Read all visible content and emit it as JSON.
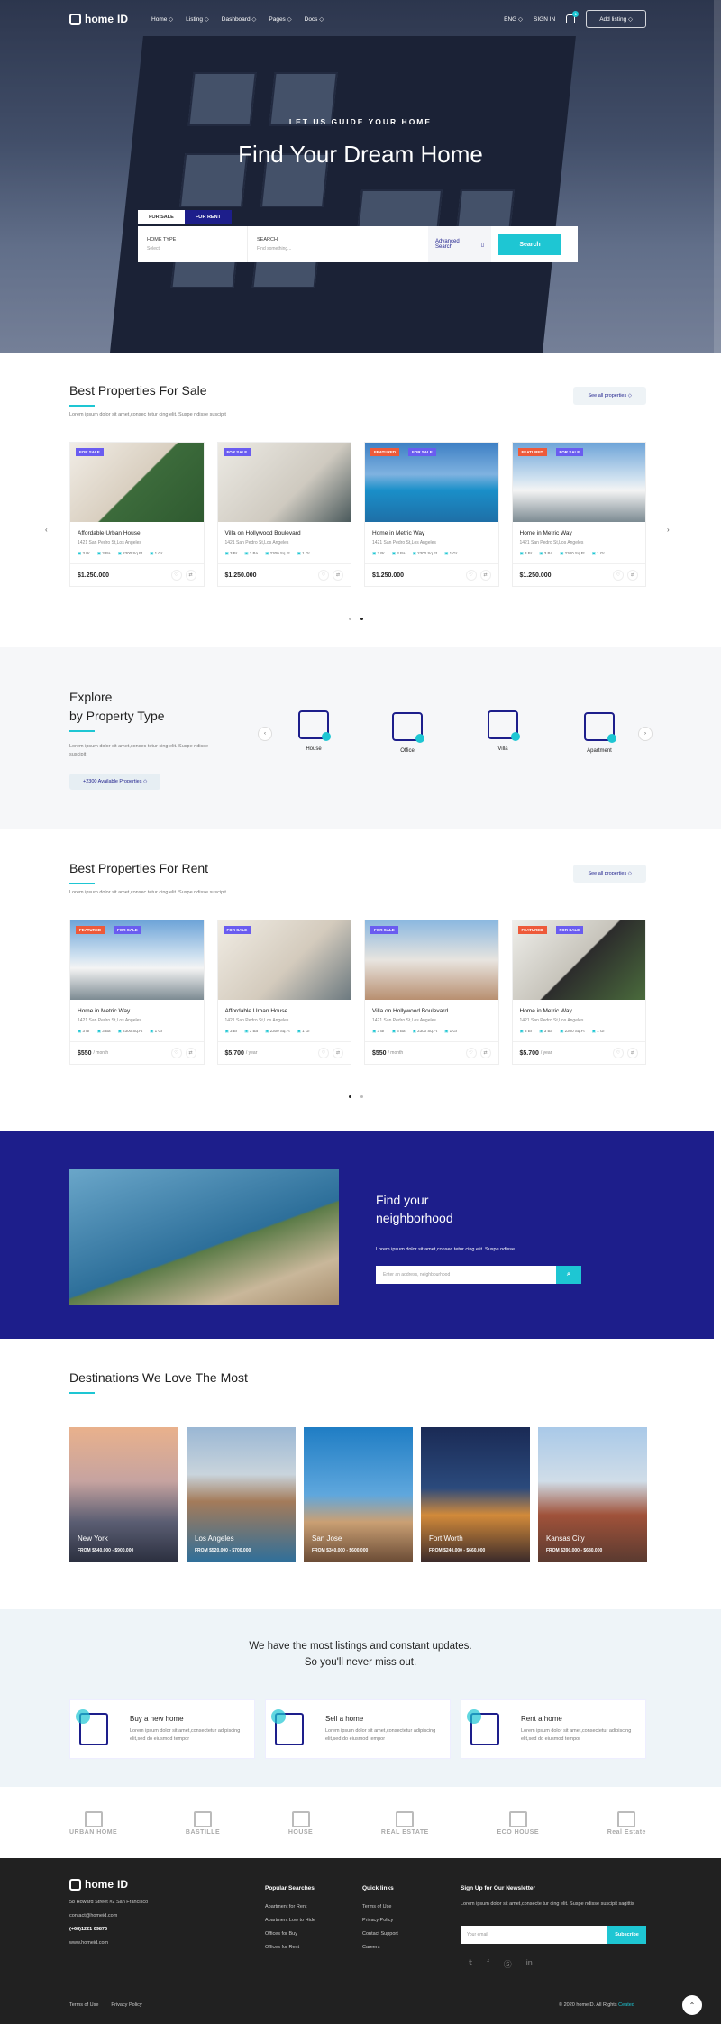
{
  "nav": {
    "logo_a": "home",
    "logo_b": "ID",
    "menu": [
      "Home ◇",
      "Listing ◇",
      "Dashboard ◇",
      "Pages ◇",
      "Docs ◇"
    ],
    "lang": "ENG ◇",
    "signin": "SIGN IN",
    "notif": "1",
    "add": "Add listing ◇"
  },
  "hero": {
    "kicker": "LET US GUIDE YOUR HOME",
    "title": "Find Your Dream Home",
    "tab_sale": "FOR SALE",
    "tab_rent": "FOR RENT",
    "type_label": "HOME TYPE",
    "type_value": "Select",
    "search_label": "SEARCH",
    "search_placeholder": "Find something...",
    "advanced": "Advanced Search",
    "go": "Search"
  },
  "sale": {
    "title": "Best Properties For Sale",
    "sub": "Lorem ipsum dolor sit amet,consec tetur cing elit. Suspe ndisse suscipit",
    "see_all": "See all properties  ◇",
    "cards": [
      {
        "title": "Affordable Urban House",
        "addr": "1421 San Pedro St,Los Angeles",
        "b1": "3 Br",
        "b2": "3 Ba",
        "b3": "2300 Sq.Ft",
        "b4": "1 Gr",
        "price": "$1.250.000",
        "period": "",
        "badges": [
          "FOR SALE"
        ]
      },
      {
        "title": "Villa on Hollywood Boulevard",
        "addr": "1421 San Pedro St,Los Angeles",
        "b1": "3 Br",
        "b2": "3 Ba",
        "b3": "2300 Sq.Ft",
        "b4": "1 Gr",
        "price": "$1.250.000",
        "period": "",
        "badges": [
          "FOR SALE"
        ]
      },
      {
        "title": "Home in Metric Way",
        "addr": "1421 San Pedro St,Los Angeles",
        "b1": "3 Br",
        "b2": "3 Ba",
        "b3": "2300 Sq.Ft",
        "b4": "1 Gr",
        "price": "$1.250.000",
        "period": "",
        "badges": [
          "FEATURED",
          "FOR SALE"
        ]
      },
      {
        "title": "Home in Metric Way",
        "addr": "1421 San Pedro St,Los Angeles",
        "b1": "3 Br",
        "b2": "3 Ba",
        "b3": "2300 Sq.Ft",
        "b4": "1 Gr",
        "price": "$1.250.000",
        "period": "",
        "badges": [
          "FEATURED",
          "FOR SALE"
        ]
      }
    ]
  },
  "explore": {
    "t1": "Explore",
    "t2": "by Property Type",
    "sub": "Lorem ipsum dolor sit amet,consec tetur cing elit. Suspe ndisse suscipit",
    "btn": "+2300 Available Properties  ◇",
    "types": [
      "House",
      "Office",
      "Villa",
      "Apartment"
    ]
  },
  "rent": {
    "title": "Best Properties For Rent",
    "sub": "Lorem ipsum dolor sit amet,consec tetur cing elit. Suspe ndisse suscipit",
    "see_all": "See all properties  ◇",
    "cards": [
      {
        "title": "Home in Metric Way",
        "addr": "1421 San Pedro St,Los Angeles",
        "b1": "3 Br",
        "b2": "3 Ba",
        "b3": "2300 Sq.Ft",
        "b4": "1 Gr",
        "price": "$550",
        "period": "/ month",
        "badges": [
          "FEATURED",
          "FOR SALE"
        ]
      },
      {
        "title": "Affordable Urban House",
        "addr": "1421 San Pedro St,Los Angeles",
        "b1": "3 Br",
        "b2": "3 Ba",
        "b3": "2300 Sq.Ft",
        "b4": "1 Gr",
        "price": "$5.700",
        "period": "/ year",
        "badges": [
          "FOR SALE"
        ]
      },
      {
        "title": "Villa on Hollywood Boulevard",
        "addr": "1421 San Pedro St,Los Angeles",
        "b1": "3 Br",
        "b2": "3 Ba",
        "b3": "2300 Sq.Ft",
        "b4": "1 Gr",
        "price": "$550",
        "period": "/ month",
        "badges": [
          "FOR SALE"
        ]
      },
      {
        "title": "Home in Metric Way",
        "addr": "1421 San Pedro St,Los Angeles",
        "b1": "3 Br",
        "b2": "3 Ba",
        "b3": "2300 Sq.Ft",
        "b4": "1 Gr",
        "price": "$5.700",
        "period": "/ year",
        "badges": [
          "FEATURED",
          "FOR SALE"
        ]
      }
    ]
  },
  "nbh": {
    "title1": "Find your",
    "title2": "neighborhood",
    "sub": "Lorem ipsum dolor sit amet,consec tetur cing elit. Suspe ndisse",
    "placeholder": "Enter an address, neighbourhood"
  },
  "dest": {
    "title": "Destinations We Love The Most",
    "items": [
      {
        "name": "New York",
        "price": "FROM  $540.000 - $900.000"
      },
      {
        "name": "Los Angeles",
        "price": "FROM  $520.000 - $700.000"
      },
      {
        "name": "San Jose",
        "price": "FROM  $340.000 - $600.000"
      },
      {
        "name": "Fort Worth",
        "price": "FROM  $240.000 - $660.000"
      },
      {
        "name": "Kansas City",
        "price": "FROM  $390.000 - $680.000"
      }
    ]
  },
  "updates": {
    "l1": "We have the most listings and constant updates.",
    "l2": "So you'll never miss out.",
    "svc": [
      {
        "t": "Buy a new home",
        "d": "Lorem ipsum dolor sit amet,consectetur adipiscing elit,sed do eiusmod tempor"
      },
      {
        "t": "Sell a home",
        "d": "Lorem ipsum dolor sit amet,consectetur adipiscing elit,sed do eiusmod tempor"
      },
      {
        "t": "Rent a home",
        "d": "Lorem ipsum dolor sit amet,consectetur adipiscing elit,sed do eiusmod tempor"
      }
    ]
  },
  "brands": [
    "URBAN HOME",
    "BASTILLE",
    "HOUSE",
    "REAL ESTATE",
    "ECO HOUSE",
    "Real Estate"
  ],
  "footer": {
    "addr": "58 Howard Street #2 San Francisco",
    "email": "contact@homeid.com",
    "phone": "(+68)1221 09876",
    "web": "www.homeid.com",
    "c2": "Popular Searches",
    "c2i": [
      "Apartment for Rent",
      "Apartment Low to Hide",
      "Offices for Buy",
      "Offices for Rent"
    ],
    "c3": "Quick links",
    "c3i": [
      "Terms of Use",
      "Privacy Policy",
      "Contact Support",
      "Careers"
    ],
    "c4": "Sign Up for Our Newsletter",
    "c4d": "Lorem ipsum dolor sit amet,consecte tur cing elit. Suspe ndisse suscipit sagittis",
    "nl_ph": "Your email",
    "nl_btn": "Subscribe",
    "terms": "Terms of Use",
    "privacy": "Privacy Policy",
    "copy": "© 2020 homeID. All Rights",
    "copy_link": "Ceated"
  },
  "colors": {
    "accent": "#1ec6d3",
    "primary": "#1d1e8b",
    "featured": "#ee5a3a",
    "sale": "#6a5cf0"
  }
}
